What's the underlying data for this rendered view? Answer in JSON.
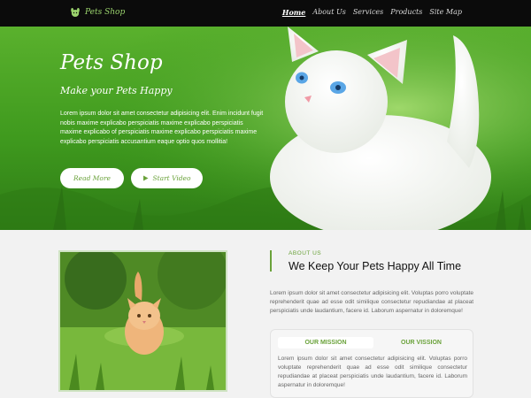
{
  "nav": {
    "logo_text": "Pets Shop",
    "items": [
      {
        "label": "Home",
        "active": true
      },
      {
        "label": "About Us",
        "active": false
      },
      {
        "label": "Services",
        "active": false
      },
      {
        "label": "Products",
        "active": false
      },
      {
        "label": "Site Map",
        "active": false
      }
    ]
  },
  "hero": {
    "title": "Pets Shop",
    "subtitle": "Make your Pets Happy",
    "text": "Lorem ipsum dolor sit amet consectetur adipisicing elit. Enim incidunt fugit nobis maxime explicabo perspiciatis maxime explicabo perspiciatis maxime explicabo of perspiciatis maxime explicabo perspiciatis maxime explicabo perspiciatis accusantium eaque optio quos mollitia!",
    "read_more_label": "Read More",
    "start_video_label": "Start Video"
  },
  "about": {
    "label": "ABOUT US",
    "heading": "We Keep Your Pets Happy All Time",
    "text": "Lorem ipsum dolor sit amet consectetur adipisicing elit. Voluptas porro voluptate reprehenderit quae ad esse odit similique consectetur repudiandae at placeat perspiciatis unde laudantium, facere id. Laborum aspernatur in doloremque!",
    "tabs": {
      "mission_label": "OUR MISSION",
      "vision_label": "OUR VISSION",
      "mission_text": "Lorem ipsum dolor sit amet consectetur adipisicing elit. Voluptas porro voluptate reprehenderit quae ad esse odit similique consectetur repudiandae at placeat perspiciatis unde laudantium, facere id. Laborum aspernatur in doloremque!"
    }
  },
  "colors": {
    "accent": "#6aa23a",
    "nav_bg": "#0b0b0b",
    "hero_green": "#4aa625"
  },
  "icons": {
    "logo": "dog-icon",
    "video": "play-icon"
  }
}
